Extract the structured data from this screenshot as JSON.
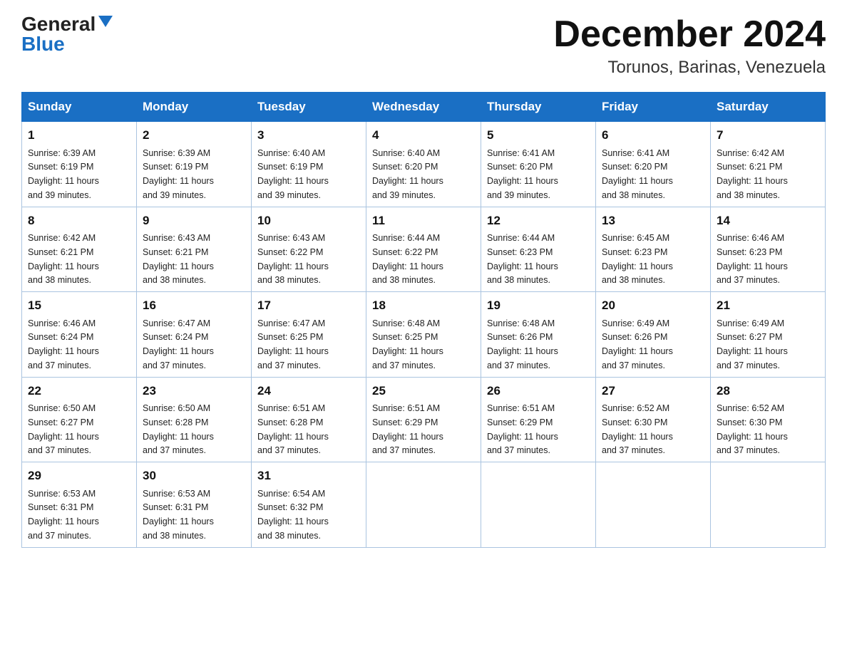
{
  "header": {
    "logo_general": "General",
    "logo_blue": "Blue",
    "month_title": "December 2024",
    "location": "Torunos, Barinas, Venezuela"
  },
  "days_of_week": [
    "Sunday",
    "Monday",
    "Tuesday",
    "Wednesday",
    "Thursday",
    "Friday",
    "Saturday"
  ],
  "weeks": [
    [
      {
        "day": "1",
        "sunrise": "6:39 AM",
        "sunset": "6:19 PM",
        "daylight": "11 hours and 39 minutes."
      },
      {
        "day": "2",
        "sunrise": "6:39 AM",
        "sunset": "6:19 PM",
        "daylight": "11 hours and 39 minutes."
      },
      {
        "day": "3",
        "sunrise": "6:40 AM",
        "sunset": "6:19 PM",
        "daylight": "11 hours and 39 minutes."
      },
      {
        "day": "4",
        "sunrise": "6:40 AM",
        "sunset": "6:20 PM",
        "daylight": "11 hours and 39 minutes."
      },
      {
        "day": "5",
        "sunrise": "6:41 AM",
        "sunset": "6:20 PM",
        "daylight": "11 hours and 39 minutes."
      },
      {
        "day": "6",
        "sunrise": "6:41 AM",
        "sunset": "6:20 PM",
        "daylight": "11 hours and 38 minutes."
      },
      {
        "day": "7",
        "sunrise": "6:42 AM",
        "sunset": "6:21 PM",
        "daylight": "11 hours and 38 minutes."
      }
    ],
    [
      {
        "day": "8",
        "sunrise": "6:42 AM",
        "sunset": "6:21 PM",
        "daylight": "11 hours and 38 minutes."
      },
      {
        "day": "9",
        "sunrise": "6:43 AM",
        "sunset": "6:21 PM",
        "daylight": "11 hours and 38 minutes."
      },
      {
        "day": "10",
        "sunrise": "6:43 AM",
        "sunset": "6:22 PM",
        "daylight": "11 hours and 38 minutes."
      },
      {
        "day": "11",
        "sunrise": "6:44 AM",
        "sunset": "6:22 PM",
        "daylight": "11 hours and 38 minutes."
      },
      {
        "day": "12",
        "sunrise": "6:44 AM",
        "sunset": "6:23 PM",
        "daylight": "11 hours and 38 minutes."
      },
      {
        "day": "13",
        "sunrise": "6:45 AM",
        "sunset": "6:23 PM",
        "daylight": "11 hours and 38 minutes."
      },
      {
        "day": "14",
        "sunrise": "6:46 AM",
        "sunset": "6:23 PM",
        "daylight": "11 hours and 37 minutes."
      }
    ],
    [
      {
        "day": "15",
        "sunrise": "6:46 AM",
        "sunset": "6:24 PM",
        "daylight": "11 hours and 37 minutes."
      },
      {
        "day": "16",
        "sunrise": "6:47 AM",
        "sunset": "6:24 PM",
        "daylight": "11 hours and 37 minutes."
      },
      {
        "day": "17",
        "sunrise": "6:47 AM",
        "sunset": "6:25 PM",
        "daylight": "11 hours and 37 minutes."
      },
      {
        "day": "18",
        "sunrise": "6:48 AM",
        "sunset": "6:25 PM",
        "daylight": "11 hours and 37 minutes."
      },
      {
        "day": "19",
        "sunrise": "6:48 AM",
        "sunset": "6:26 PM",
        "daylight": "11 hours and 37 minutes."
      },
      {
        "day": "20",
        "sunrise": "6:49 AM",
        "sunset": "6:26 PM",
        "daylight": "11 hours and 37 minutes."
      },
      {
        "day": "21",
        "sunrise": "6:49 AM",
        "sunset": "6:27 PM",
        "daylight": "11 hours and 37 minutes."
      }
    ],
    [
      {
        "day": "22",
        "sunrise": "6:50 AM",
        "sunset": "6:27 PM",
        "daylight": "11 hours and 37 minutes."
      },
      {
        "day": "23",
        "sunrise": "6:50 AM",
        "sunset": "6:28 PM",
        "daylight": "11 hours and 37 minutes."
      },
      {
        "day": "24",
        "sunrise": "6:51 AM",
        "sunset": "6:28 PM",
        "daylight": "11 hours and 37 minutes."
      },
      {
        "day": "25",
        "sunrise": "6:51 AM",
        "sunset": "6:29 PM",
        "daylight": "11 hours and 37 minutes."
      },
      {
        "day": "26",
        "sunrise": "6:51 AM",
        "sunset": "6:29 PM",
        "daylight": "11 hours and 37 minutes."
      },
      {
        "day": "27",
        "sunrise": "6:52 AM",
        "sunset": "6:30 PM",
        "daylight": "11 hours and 37 minutes."
      },
      {
        "day": "28",
        "sunrise": "6:52 AM",
        "sunset": "6:30 PM",
        "daylight": "11 hours and 37 minutes."
      }
    ],
    [
      {
        "day": "29",
        "sunrise": "6:53 AM",
        "sunset": "6:31 PM",
        "daylight": "11 hours and 37 minutes."
      },
      {
        "day": "30",
        "sunrise": "6:53 AM",
        "sunset": "6:31 PM",
        "daylight": "11 hours and 38 minutes."
      },
      {
        "day": "31",
        "sunrise": "6:54 AM",
        "sunset": "6:32 PM",
        "daylight": "11 hours and 38 minutes."
      },
      null,
      null,
      null,
      null
    ]
  ],
  "labels": {
    "sunrise": "Sunrise:",
    "sunset": "Sunset:",
    "daylight": "Daylight:"
  }
}
